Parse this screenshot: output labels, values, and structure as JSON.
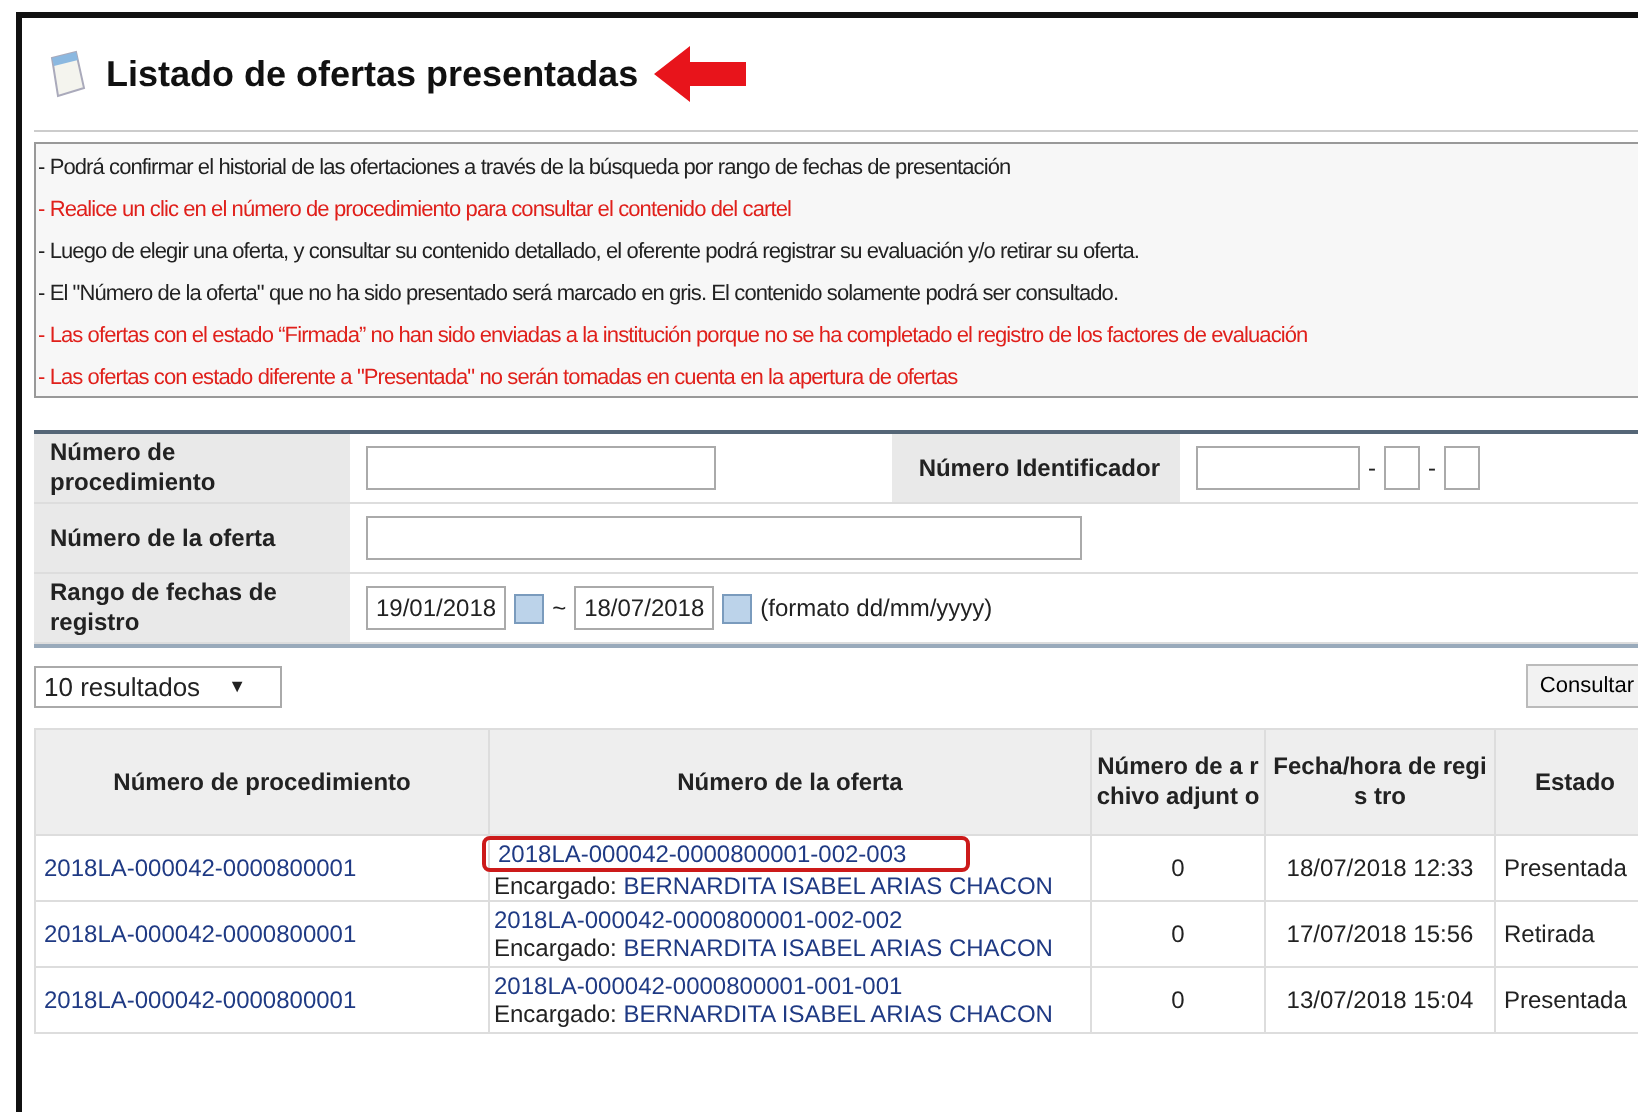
{
  "title": "Listado de ofertas presentadas",
  "notes": [
    {
      "text": "- Podrá confirmar el historial de las ofertaciones a través de la búsqueda por rango de fechas de presentación",
      "kind": "info"
    },
    {
      "text": "- Realice un clic en el número de procedimiento para consultar el contenido del cartel",
      "kind": "warning"
    },
    {
      "text": "- Luego de elegir una oferta, y consultar su contenido detallado, el oferente podrá registrar su evaluación y/o retirar su oferta.",
      "kind": "info"
    },
    {
      "text": "- El \"Número de la oferta\" que no ha sido presentado será marcado en gris. El contenido solamente podrá ser consultado.",
      "kind": "info"
    },
    {
      "text": "- Las ofertas con el estado “Firmada” no han sido enviadas a la institución porque no se ha completado el registro de los factores de evaluación",
      "kind": "warning"
    },
    {
      "text": "- Las ofertas con estado diferente a \"Presentada\" no serán tomadas en cuenta en la apertura de ofertas",
      "kind": "warning"
    }
  ],
  "form": {
    "procedure_label": "Número de procedimiento",
    "identifier_label": "Número Identificador",
    "separator_1": "-",
    "separator_2": "-",
    "offer_label": "Número de la oferta",
    "date_label": "Rango de fechas de registro",
    "date_from": "19/01/2018",
    "tilde": "~",
    "date_to": "18/07/2018",
    "format_hint": "(formato dd/mm/yyyy)"
  },
  "results_select": {
    "value": "10 resultados",
    "caret": "▼"
  },
  "search_button": "Consultar",
  "table": {
    "columns": [
      "Número de procedimiento",
      "Número de la oferta",
      "Número de a rchivo adjunt o",
      "Fecha/hora de regis tro",
      "Estado"
    ],
    "rows": [
      {
        "procedure": "2018LA-000042-0000800001",
        "offer": "2018LA-000042-0000800001-002-003",
        "manager_label": "Encargado:",
        "manager": "BERNARDITA ISABEL ARIAS CHACON",
        "attachments": "0",
        "date": "18/07/2018 12:33",
        "status": "Presentada",
        "highlighted": true
      },
      {
        "procedure": "2018LA-000042-0000800001",
        "offer": "2018LA-000042-0000800001-002-002",
        "manager_label": "Encargado:",
        "manager": "BERNARDITA ISABEL ARIAS CHACON",
        "attachments": "0",
        "date": "17/07/2018 15:56",
        "status": "Retirada",
        "highlighted": false
      },
      {
        "procedure": "2018LA-000042-0000800001",
        "offer": "2018LA-000042-0000800001-001-001",
        "manager_label": "Encargado:",
        "manager": "BERNARDITA ISABEL ARIAS CHACON",
        "attachments": "0",
        "date": "13/07/2018 15:04",
        "status": "Presentada",
        "highlighted": false
      }
    ]
  }
}
